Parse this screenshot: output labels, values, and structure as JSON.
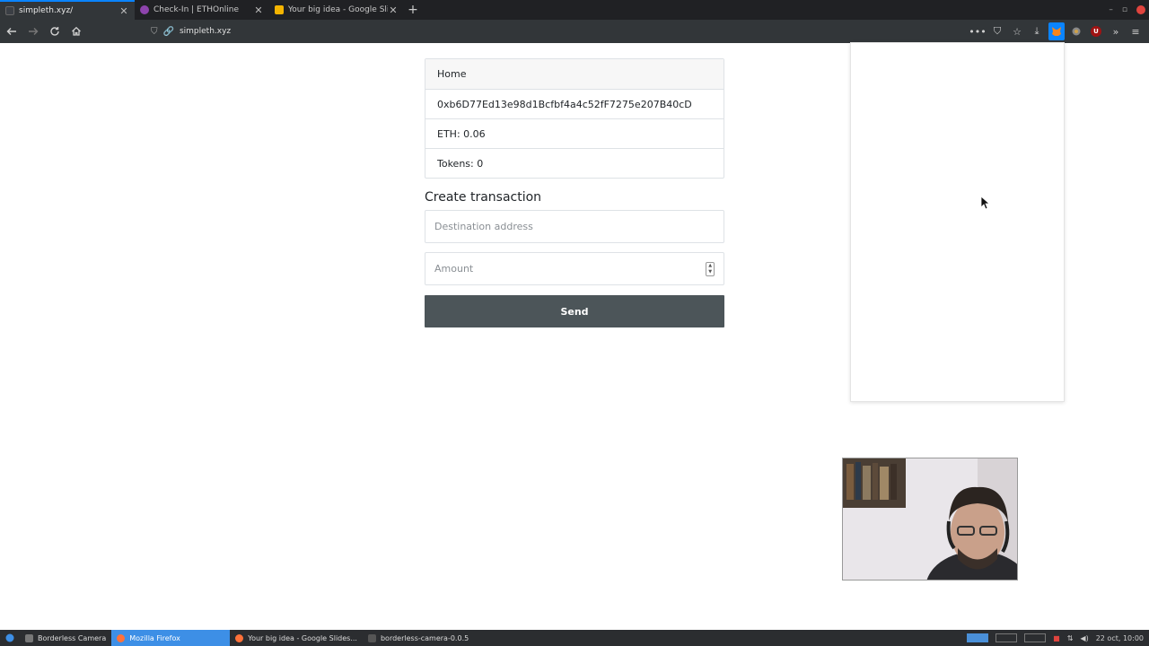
{
  "browser": {
    "tabs": [
      {
        "title": "simpleth.xyz/",
        "active": true,
        "favicon_color": "#3b3f45"
      },
      {
        "title": "Check-In | ETHOnline",
        "active": false,
        "favicon_color": "#8e44ad"
      },
      {
        "title": "Your big idea - Google Slides",
        "active": false,
        "favicon_color": "#f4b400"
      }
    ],
    "url": "simpleth.xyz"
  },
  "page": {
    "info_items": [
      "Home",
      "0xb6D77Ed13e98d1Bcfbf4a4c52fF7275e207B40cD",
      "ETH: 0.06",
      "Tokens: 0"
    ],
    "create_title": "Create transaction",
    "destination_placeholder": "Destination address",
    "amount_placeholder": "Amount",
    "send_label": "Send"
  },
  "taskbar": {
    "items": [
      {
        "label": "Borderless Camera",
        "active": false,
        "icon_color": "#777777"
      },
      {
        "label": "Mozilla Firefox",
        "active": true,
        "icon_color": "#ff7139"
      },
      {
        "label": "Your big idea - Google Slides...",
        "active": false,
        "icon_color": "#ff7139"
      },
      {
        "label": "borderless-camera-0.0.5",
        "active": false,
        "icon_color": "#555555"
      }
    ],
    "clock": "22 oct, 10:00"
  },
  "colors": {
    "accent": "#0a84ff",
    "send_button": "#4c5559"
  }
}
